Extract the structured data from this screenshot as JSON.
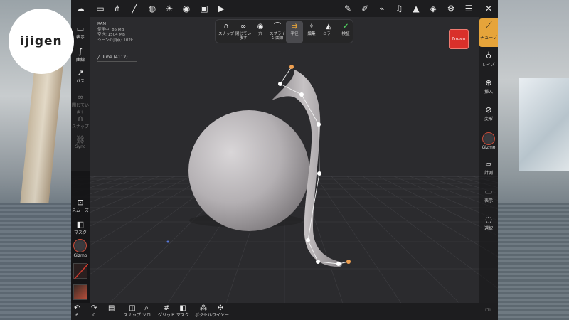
{
  "logo": {
    "text": "ijigen"
  },
  "info": {
    "ram_label": "RAM",
    "used": "使用中: 85 MB",
    "free": "空き: 1504 MB",
    "scene_verts": "シーンの頂点: 102k",
    "object_name": "Tube (4112)"
  },
  "top_toolbar": {
    "icons": [
      "cloud-icon",
      "folder-icon",
      "scene-graph-icon",
      "stroke-icon",
      "globe-icon",
      "sun-icon",
      "material-icon",
      "image-icon",
      "video-icon",
      "pen-icon",
      "brush-icon",
      "eyedropper-icon",
      "trumpet-icon",
      "triangle-icon",
      "layers-icon",
      "settings-icon",
      "sliders-icon",
      "tools-icon"
    ]
  },
  "left_rail": {
    "items": [
      {
        "label": "表示",
        "icon": "camera-icon",
        "dim": false
      },
      {
        "label": "曲線",
        "icon": "curve-icon",
        "dim": false
      },
      {
        "label": "パス",
        "icon": "path-icon",
        "dim": false
      },
      {
        "label": "閉じています",
        "icon": "link-icon",
        "dim": true
      },
      {
        "label": "スナップ",
        "icon": "magnet-icon",
        "dim": true
      },
      {
        "label": "Sync",
        "icon": "chain-icon",
        "dim": true
      }
    ],
    "bottom": [
      {
        "label": "スムーズ",
        "icon": "smooth-icon"
      },
      {
        "label": "マスク",
        "icon": "mask-icon"
      },
      {
        "label": "Gizmo",
        "icon": "gizmo-icon"
      }
    ]
  },
  "palette": {
    "items": [
      {
        "label": "スナップ",
        "icon": "magnet-icon"
      },
      {
        "label": "閉じています",
        "icon": "infinity-icon"
      },
      {
        "label": "穴",
        "icon": "eye-icon"
      },
      {
        "label": "スプライン曲線",
        "icon": "spline-icon"
      },
      {
        "label": "半径",
        "icon": "radius-icon"
      },
      {
        "label": "編集",
        "icon": "edit-icon"
      },
      {
        "label": "ミラー",
        "icon": "mirror-icon"
      },
      {
        "label": "検証",
        "icon": "check-icon"
      }
    ]
  },
  "frozen": {
    "label": "Frozen",
    "color": "#d9302a"
  },
  "right_rail": {
    "active": {
      "label": "チューブ",
      "icon": "tube-icon",
      "color": "#e6a43a"
    },
    "items": [
      {
        "label": "レイズ",
        "icon": "vase-icon"
      },
      {
        "label": "挿入",
        "icon": "insert-icon"
      },
      {
        "label": "変形",
        "icon": "transform-icon"
      },
      {
        "label": "Gizmo",
        "icon": "gizmo-icon"
      },
      {
        "label": "計測",
        "icon": "ruler-icon"
      },
      {
        "label": "表示",
        "icon": "camera-icon"
      },
      {
        "label": "選択",
        "icon": "select-icon"
      }
    ]
  },
  "bottom_bar": {
    "undo": {
      "label": "6",
      "icon": "undo-icon"
    },
    "redo": {
      "label": "0",
      "icon": "redo-icon"
    },
    "items": [
      {
        "label": "...",
        "icon": "book-icon"
      },
      {
        "label": "スナップ",
        "icon": "snap-icon"
      },
      {
        "label": "ソロ",
        "icon": "search-icon"
      },
      {
        "label": "グリッド",
        "icon": "grid-icon"
      },
      {
        "label": "マスク",
        "icon": "mask-icon"
      },
      {
        "label": "ボクセル",
        "icon": "voxel-icon"
      },
      {
        "label": "ワイヤー",
        "icon": "wire-icon"
      }
    ],
    "corner": "LTI"
  }
}
